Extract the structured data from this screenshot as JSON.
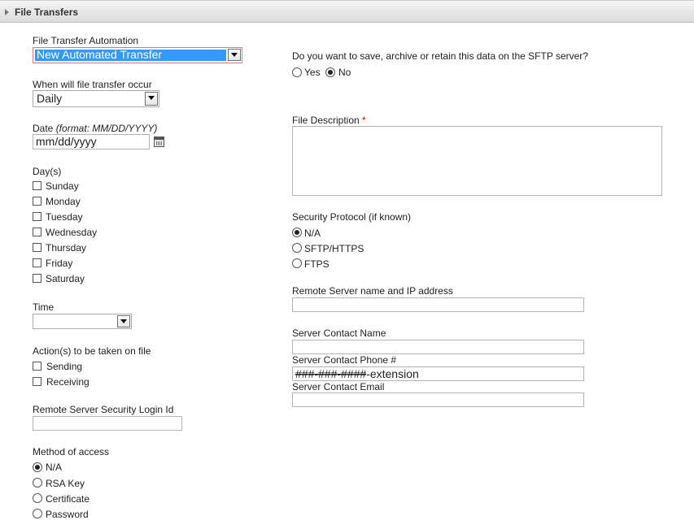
{
  "header": {
    "title": "File Transfers"
  },
  "left": {
    "automation_label": "File Transfer Automation",
    "automation_value": "New Automated Transfer",
    "frequency_label": "When will file transfer occur",
    "frequency_value": "Daily",
    "date_label": "Date ",
    "date_format_hint": "(format: MM/DD/YYYY)",
    "date_placeholder": "mm/dd/yyyy",
    "days_label": "Day(s)",
    "days": [
      "Sunday",
      "Monday",
      "Tuesday",
      "Wednesday",
      "Thursday",
      "Friday",
      "Saturday"
    ],
    "time_label": "Time",
    "time_value": "",
    "actions_label": "Action(s) to be taken on file",
    "actions": [
      "Sending",
      "Receiving"
    ],
    "login_label": "Remote Server Security Login Id",
    "login_value": "",
    "access_label": "Method of access",
    "access_options": [
      "N/A",
      "RSA Key",
      "Certificate",
      "Password"
    ],
    "access_selected": "N/A"
  },
  "right": {
    "retain_question": "Do you want to save, archive or retain this data on the SFTP server?",
    "retain_yes": "Yes",
    "retain_no": "No",
    "retain_selected": "No",
    "file_desc_label": "File Description ",
    "required_mark": "*",
    "file_desc_value": "",
    "protocol_label": "Security Protocol (if known)",
    "protocol_options": [
      "N/A",
      "SFTP/HTTPS",
      "FTPS"
    ],
    "protocol_selected": "N/A",
    "remote_server_label": "Remote Server name and IP address",
    "remote_server_value": "",
    "contact_name_label": "Server Contact Name",
    "contact_name_value": "",
    "contact_phone_label": "Server Contact Phone #",
    "contact_phone_placeholder_struck": "###-###-####",
    "contact_phone_placeholder_rest": "-extension",
    "contact_email_label": "Server Contact Email",
    "contact_email_value": ""
  }
}
